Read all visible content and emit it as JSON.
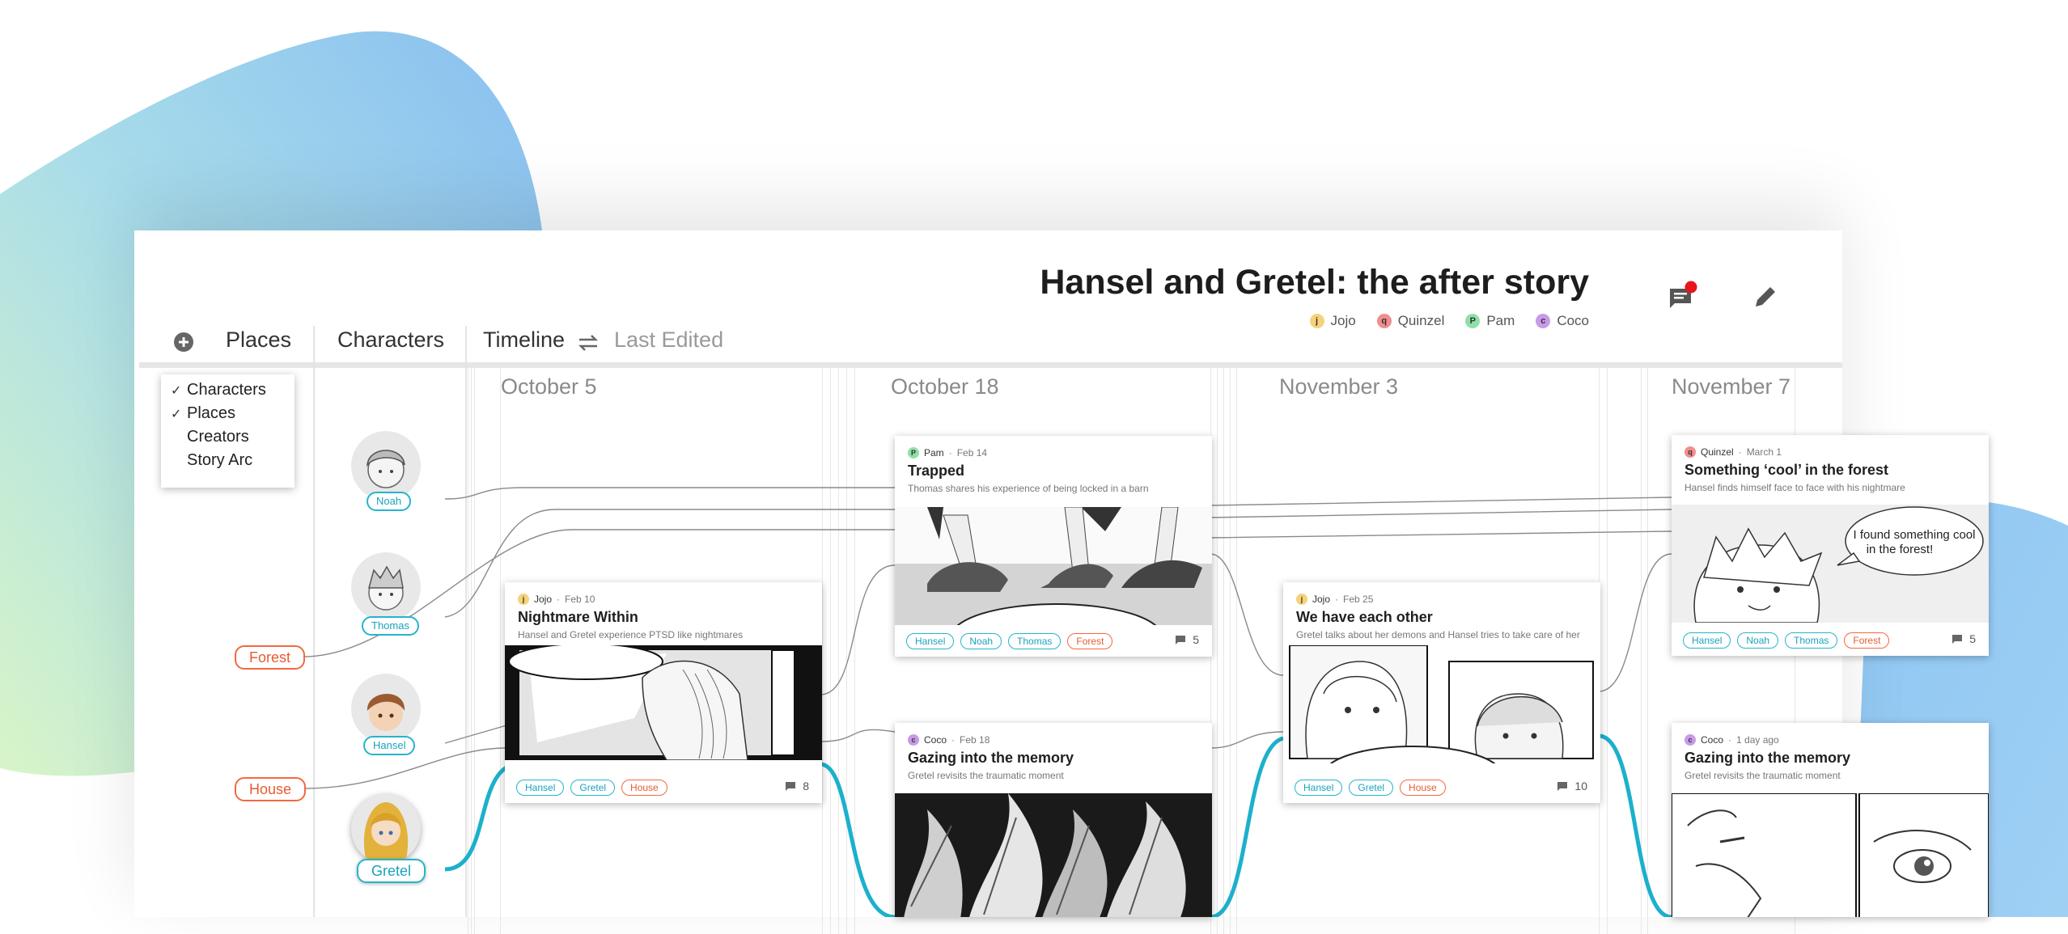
{
  "app": {
    "title": "Hansel and Gretel: the after story",
    "creators": [
      {
        "name": "Jojo",
        "initial": "j",
        "color": "#f6d37a"
      },
      {
        "name": "Quinzel",
        "initial": "q",
        "color": "#f08e8e"
      },
      {
        "name": "Pam",
        "initial": "P",
        "color": "#8fe0a8"
      },
      {
        "name": "Coco",
        "initial": "c",
        "color": "#c89ae8"
      }
    ],
    "icons": {
      "comments": "comments-icon",
      "notification_color": "#e8141c",
      "edit": "pencil-icon",
      "add": "add-circle-icon",
      "swap": "swap-arrows-icon"
    }
  },
  "tabs": {
    "places": "Places",
    "characters": "Characters",
    "timeline": "Timeline",
    "last_edited": "Last Edited"
  },
  "filter_menu": {
    "items": [
      {
        "label": "Characters",
        "checked": true
      },
      {
        "label": "Places",
        "checked": true
      },
      {
        "label": "Creators",
        "checked": false
      },
      {
        "label": "Story Arc",
        "checked": false
      }
    ]
  },
  "places": [
    {
      "label": "Forest"
    },
    {
      "label": "House"
    }
  ],
  "characters": [
    {
      "label": "Noah"
    },
    {
      "label": "Thomas"
    },
    {
      "label": "Hansel"
    },
    {
      "label": "Gretel"
    }
  ],
  "dates": [
    "October 5",
    "October 18",
    "November 3",
    "November 7"
  ],
  "cards": [
    {
      "creator": "Jojo",
      "initial": "j",
      "color": "#f6d37a",
      "date": "Feb 10",
      "title": "Nightmare Within",
      "desc": "Hansel and Gretel experience PTSD like nightmares",
      "tags": [
        {
          "label": "Hansel",
          "kind": "char"
        },
        {
          "label": "Gretel",
          "kind": "char"
        },
        {
          "label": "House",
          "kind": "place"
        }
      ],
      "comments": "8"
    },
    {
      "creator": "Pam",
      "initial": "P",
      "color": "#8fe0a8",
      "date": "Feb 14",
      "title": "Trapped",
      "desc": "Thomas shares his experience of being locked in a barn",
      "tags": [
        {
          "label": "Hansel",
          "kind": "char"
        },
        {
          "label": "Noah",
          "kind": "char"
        },
        {
          "label": "Thomas",
          "kind": "char"
        },
        {
          "label": "Forest",
          "kind": "place"
        }
      ],
      "comments": "5"
    },
    {
      "creator": "Coco",
      "initial": "c",
      "color": "#c89ae8",
      "date": "Feb 18",
      "title": "Gazing into the memory",
      "desc": "Gretel revisits the traumatic moment",
      "tags": [],
      "comments": ""
    },
    {
      "creator": "Jojo",
      "initial": "j",
      "color": "#f6d37a",
      "date": "Feb 25",
      "title": "We have each other",
      "desc": "Gretel talks about her demons and Hansel tries to take care of her",
      "tags": [
        {
          "label": "Hansel",
          "kind": "char"
        },
        {
          "label": "Gretel",
          "kind": "char"
        },
        {
          "label": "House",
          "kind": "place"
        }
      ],
      "comments": "10"
    },
    {
      "creator": "Quinzel",
      "initial": "q",
      "color": "#f08e8e",
      "date": "March 1",
      "title": "Something ‘cool’ in the forest",
      "desc": "Hansel finds himself face to face with his nightmare",
      "speech": "I found something cool in the forest!",
      "tags": [
        {
          "label": "Hansel",
          "kind": "char"
        },
        {
          "label": "Noah",
          "kind": "char"
        },
        {
          "label": "Thomas",
          "kind": "char"
        },
        {
          "label": "Forest",
          "kind": "place"
        }
      ],
      "comments": "5"
    },
    {
      "creator": "Coco",
      "initial": "c",
      "color": "#c89ae8",
      "date": "1 day ago",
      "title": "Gazing into the memory",
      "desc": "Gretel revisits the traumatic moment",
      "tags": [],
      "comments": ""
    }
  ],
  "colors": {
    "character_accent": "#26b4cc",
    "place_accent": "#f4683f"
  }
}
